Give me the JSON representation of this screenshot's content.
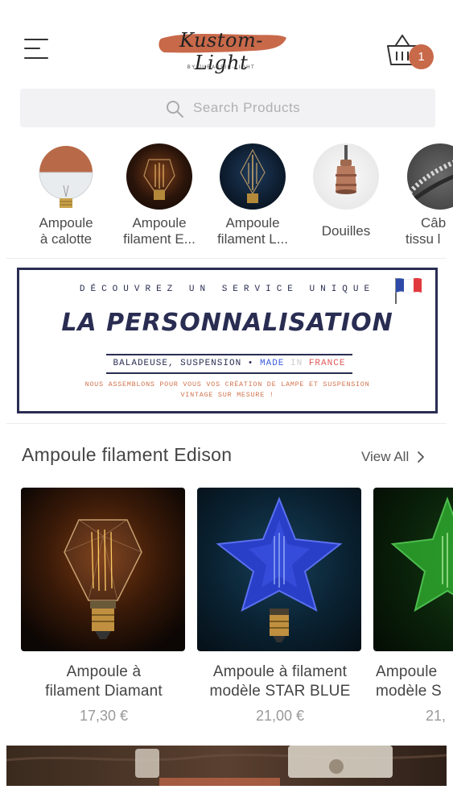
{
  "header": {
    "logo_text": "Kustom-Light",
    "logo_sub": "BY JURASSIC-LIGHT",
    "cart_count": "1",
    "accent_color": "#c8694a"
  },
  "search": {
    "placeholder": "Search Products"
  },
  "categories": [
    {
      "line1": "Ampoule",
      "line2": "à calotte"
    },
    {
      "line1": "Ampoule",
      "line2": "filament E..."
    },
    {
      "line1": "Ampoule",
      "line2": "filament L..."
    },
    {
      "line1": "Douilles",
      "line2": ""
    },
    {
      "line1": "Câb",
      "line2": "tissu l"
    }
  ],
  "banner": {
    "kicker": "DÉCOUVREZ UN SERVICE UNIQUE",
    "title": "LA PERSONNALISATION",
    "tags_prefix": "BALADEUSE, SUSPENSION",
    "tags_dot": "•",
    "tags_made": "MADE",
    "tags_in": "IN",
    "tags_france": "FRANCE",
    "subtitle_line1": "NOUS ASSEMBLONS POUR VOUS VOS CRÉATION DE LAMPE ET SUSPENSION",
    "subtitle_line2": "VINTAGE SUR MESURE !"
  },
  "section": {
    "title": "Ampoule filament Edison",
    "view_all": "View All"
  },
  "products": [
    {
      "name_line1": "Ampoule à",
      "name_line2": "filament Diamant",
      "price": "17,30 €"
    },
    {
      "name_line1": "Ampoule à filament",
      "name_line2": "modèle STAR BLUE",
      "price": "21,00 €"
    },
    {
      "name_line1": "Ampoule",
      "name_line2": "modèle S",
      "price": "21,"
    }
  ]
}
